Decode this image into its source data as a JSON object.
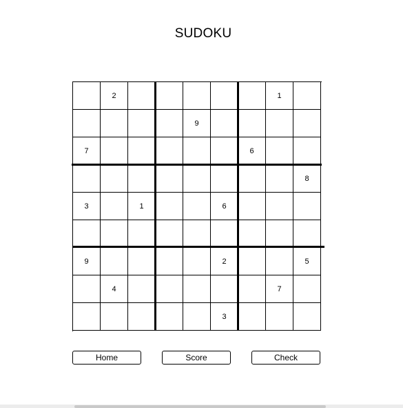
{
  "title": "SUDOKU",
  "board": [
    [
      "",
      "2",
      "",
      "",
      "",
      "",
      "",
      "1",
      ""
    ],
    [
      "",
      "",
      "",
      "",
      "9",
      "",
      "",
      "",
      ""
    ],
    [
      "7",
      "",
      "",
      "",
      "",
      "",
      "6",
      "",
      ""
    ],
    [
      "",
      "",
      "",
      "",
      "",
      "",
      "",
      "",
      "8"
    ],
    [
      "3",
      "",
      "1",
      "",
      "",
      "6",
      "",
      "",
      ""
    ],
    [
      "",
      "",
      "",
      "",
      "",
      "",
      "",
      "",
      ""
    ],
    [
      "9",
      "",
      "",
      "",
      "",
      "2",
      "",
      "",
      "5"
    ],
    [
      "",
      "4",
      "",
      "",
      "",
      "",
      "",
      "7",
      ""
    ],
    [
      "",
      "",
      "",
      "",
      "",
      "3",
      "",
      "",
      ""
    ]
  ],
  "buttons": {
    "home": "Home",
    "score": "Score",
    "check": "Check"
  }
}
